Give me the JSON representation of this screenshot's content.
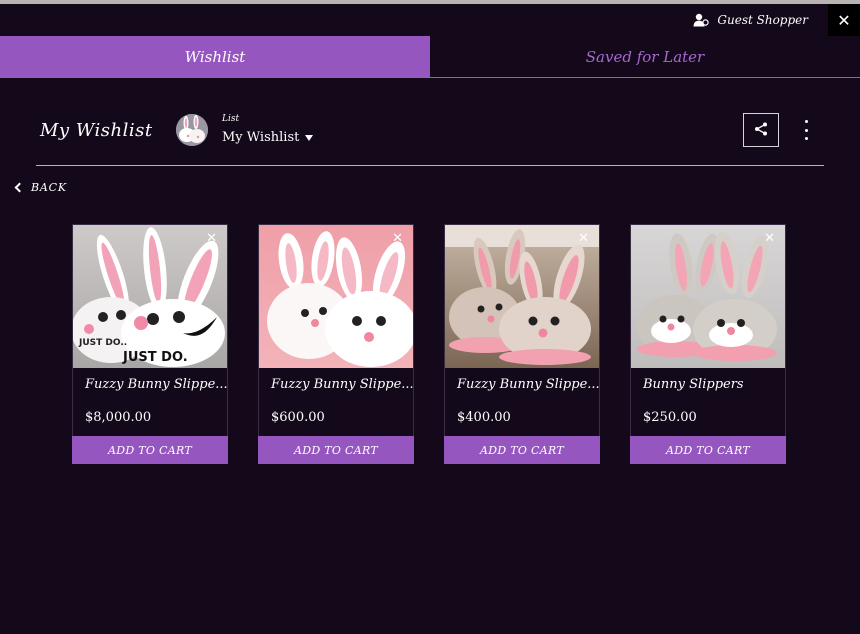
{
  "header": {
    "user_name": "Guest Shopper",
    "close_glyph": "✕"
  },
  "tabs": [
    {
      "label": "Wishlist",
      "active": true
    },
    {
      "label": "Saved for Later",
      "active": false
    }
  ],
  "list": {
    "title": "My Wishlist",
    "selector_label": "List",
    "selected_list": "My Wishlist"
  },
  "back_label": "BACK",
  "products": [
    {
      "name": "Fuzzy Bunny Slippe...",
      "price": "$8,000.00",
      "cart_label": "ADD TO CART",
      "slipper_color": "#ffffff",
      "ear_inner": "#f2a3b8",
      "bg": "bg1",
      "logo_text": "JUST DO."
    },
    {
      "name": "Fuzzy Bunny Slippe...",
      "price": "$600.00",
      "cart_label": "ADD TO CART",
      "slipper_color": "#ffffff",
      "ear_inner": "#f5b9c6",
      "bg": "bg2"
    },
    {
      "name": "Fuzzy Bunny Slippe...",
      "price": "$400.00",
      "cart_label": "ADD TO CART",
      "slipper_color": "#d9c8bd",
      "ear_inner": "#f09aac",
      "bg": "bg3"
    },
    {
      "name": "Bunny Slippers",
      "price": "$250.00",
      "cart_label": "ADD TO CART",
      "slipper_color": "#cfc9c4",
      "ear_inner": "#f3a5b5",
      "bg": "bg4"
    }
  ],
  "icons": {
    "user": "user-icon",
    "share": "share-icon",
    "more": "more-vertical-icon",
    "back": "chevron-left-icon",
    "remove": "close-icon"
  },
  "colors": {
    "background": "#13091a",
    "accent": "#9656c0",
    "accent_text": "#a767d0"
  }
}
